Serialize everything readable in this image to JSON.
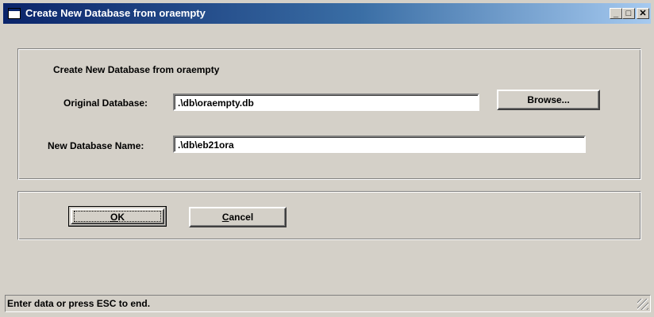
{
  "window": {
    "title": "Create New Database from oraempty",
    "minimize_label": "_",
    "maximize_label": "□",
    "close_label": "✕"
  },
  "form": {
    "heading": "Create New Database from oraempty",
    "original_label": "Original Database:",
    "original_value": ".\\db\\oraempty.db",
    "new_label": "New Database Name:",
    "new_value": ".\\db\\eb21ora",
    "browse_label": "Browse..."
  },
  "buttons": {
    "ok_label": "OK",
    "ok_mnemonic": "O",
    "ok_rest": "K",
    "cancel_mnemonic": "C",
    "cancel_rest": "ancel"
  },
  "status": {
    "text": "Enter data or press ESC to end."
  }
}
